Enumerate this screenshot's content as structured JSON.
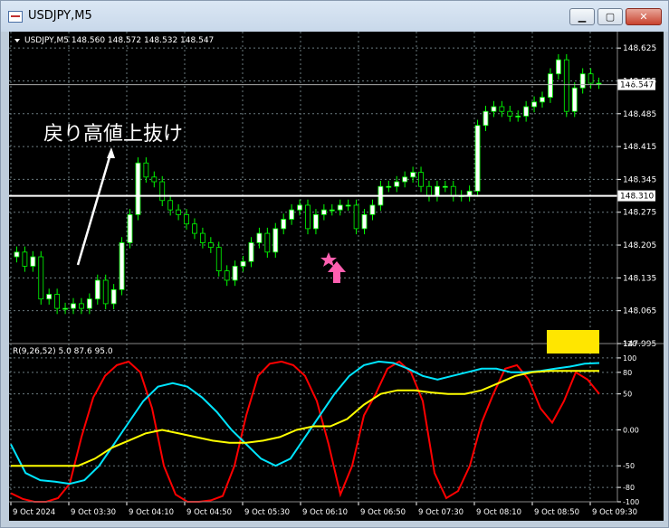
{
  "window": {
    "title": "USDJPY,M5",
    "minimize_icon": "minimize-icon",
    "maximize_icon": "maximize-icon",
    "close_icon": "close-icon",
    "minimize_glyph": "▁",
    "maximize_glyph": "▢",
    "close_glyph": "✕"
  },
  "chart": {
    "info_line": "USDJPY,M5  148.560 148.572 148.532 148.547",
    "annotation_text": "戻り高値上抜け",
    "bid_price_label": "148.547",
    "hline_price_label": "148.310",
    "indicator_label": "R(9,26,52) 5.0 87.6 95.0",
    "price_ticks": [
      "148.625",
      "148.555",
      "148.485",
      "148.415",
      "148.345",
      "148.275",
      "148.205",
      "148.135",
      "148.065",
      "147.995"
    ],
    "time_ticks": [
      "9 Oct 2024",
      "9 Oct 03:30",
      "9 Oct 04:10",
      "9 Oct 04:50",
      "9 Oct 05:30",
      "9 Oct 06:10",
      "9 Oct 06:50",
      "9 Oct 07:30",
      "9 Oct 08:10",
      "9 Oct 08:50",
      "9 Oct 09:30"
    ],
    "indicator_ticks": [
      "120",
      "100",
      "80",
      "50",
      "0.00",
      "-50",
      "-80",
      "-100"
    ],
    "colors": {
      "background": "#000000",
      "candle": "#00ff00",
      "bull_body": "#ffffff",
      "bear_body": "#000000",
      "grid": "#6b7b80",
      "text": "#ffffff",
      "red_line": "#ff0000",
      "cyan_line": "#00e5ff",
      "yellow_line": "#ffff00",
      "star": "#ff5fb0",
      "arrow": "#ff5fb0",
      "yellow_box": "#ffe600"
    },
    "markers": [
      "star-icon",
      "up-arrow-icon"
    ]
  },
  "chart_data": [
    {
      "type": "candlestick",
      "symbol": "USDJPY",
      "timeframe": "M5",
      "ohlc_current": [
        148.56,
        148.572,
        148.532,
        148.547
      ],
      "ylim": [
        147.995,
        148.66
      ],
      "hline": 148.31,
      "last_price": 148.547,
      "closes": [
        148.19,
        148.16,
        148.18,
        148.09,
        148.1,
        148.07,
        148.07,
        148.08,
        148.07,
        148.09,
        148.13,
        148.08,
        148.11,
        148.21,
        148.27,
        148.38,
        148.35,
        148.34,
        148.3,
        148.28,
        148.27,
        148.25,
        148.23,
        148.21,
        148.2,
        148.15,
        148.13,
        148.16,
        148.17,
        148.21,
        148.23,
        148.19,
        148.24,
        148.26,
        148.28,
        148.29,
        148.24,
        148.27,
        148.28,
        148.28,
        148.29,
        148.29,
        148.24,
        148.27,
        148.29,
        148.33,
        148.33,
        148.34,
        148.35,
        148.36,
        148.33,
        148.31,
        148.33,
        148.33,
        148.31,
        148.31,
        148.32,
        148.46,
        148.49,
        148.5,
        148.49,
        148.48,
        148.48,
        148.5,
        148.51,
        148.52,
        148.57,
        148.6,
        148.49,
        148.54,
        148.57,
        148.55,
        148.55
      ]
    },
    {
      "type": "line",
      "title": "R(9,26,52)",
      "values_current": [
        5.0,
        87.6,
        95.0
      ],
      "ylim": [
        -100,
        120
      ],
      "levels": [
        100,
        80,
        50,
        0,
        -50,
        -80,
        -100
      ],
      "series": [
        {
          "values": [
            -88,
            -96,
            -100,
            -100,
            -95,
            -75,
            -10,
            45,
            75,
            90,
            95,
            80,
            30,
            -50,
            -90,
            -100,
            -100,
            -98,
            -92,
            -50,
            20,
            75,
            92,
            95,
            90,
            75,
            40,
            -20,
            -90,
            -50,
            20,
            50,
            85,
            95,
            80,
            40,
            -60,
            -95,
            -85,
            -50,
            10,
            50,
            85,
            90,
            70,
            30,
            10,
            40,
            80,
            70,
            50
          ]
        },
        {
          "values": [
            -20,
            -60,
            -70,
            -72,
            -75,
            -70,
            -50,
            -20,
            10,
            40,
            60,
            65,
            60,
            45,
            25,
            0,
            -20,
            -40,
            -50,
            -40,
            -10,
            20,
            50,
            75,
            90,
            95,
            93,
            85,
            75,
            70,
            75,
            80,
            85,
            85,
            80,
            80,
            82,
            85,
            88,
            92,
            93
          ]
        },
        {
          "values": [
            -50,
            -50,
            -50,
            -50,
            -50,
            -40,
            -25,
            -15,
            -5,
            0,
            -5,
            -10,
            -15,
            -18,
            -18,
            -15,
            -10,
            0,
            5,
            5,
            15,
            35,
            50,
            55,
            55,
            52,
            50,
            50,
            55,
            65,
            75,
            80,
            82,
            82,
            82,
            82
          ]
        }
      ]
    }
  ]
}
